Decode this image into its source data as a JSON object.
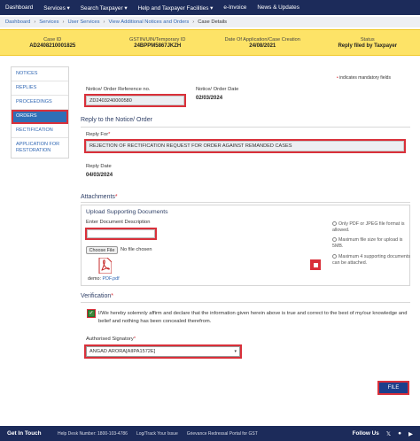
{
  "nav": {
    "items": [
      "Dashboard",
      "Services ▾",
      "Search Taxpayer ▾",
      "Help and Taxpayer Facilities ▾",
      "e-Invoice",
      "News & Updates"
    ]
  },
  "breadcrumb": [
    "Dashboard",
    "Services",
    "User Services",
    "View Additional Notices and Orders",
    "Case Details"
  ],
  "case_info": [
    {
      "label": "Case ID",
      "value": "AD2408210001825"
    },
    {
      "label": "GSTIN/UIN/Temporary ID",
      "value": "24BPPM5867JKZH"
    },
    {
      "label": "Date Of Application/Case Creation",
      "value": "24/08/2021"
    },
    {
      "label": "Status",
      "value": "Reply filed by Taxpayer"
    }
  ],
  "sidebar": {
    "items": [
      "NOTICES",
      "REPLIES",
      "PROCEEDINGS",
      "ORDERS",
      "RECTIFICATION",
      "APPLICATION FOR RESTORATION"
    ]
  },
  "mandatory_note": "indicates mandatory fields",
  "order": {
    "ref_label": "Notice/ Order Reference no.",
    "ref_value": "ZD2403240000580",
    "date_label": "Notice/ Order Date",
    "date_value": "02/03/2024"
  },
  "reply": {
    "section_title": "Reply to the Notice/ Order",
    "reply_for_label": "Reply For",
    "reply_for_value": "REJECTION OF RECTIFICATION REQUEST FOR ORDER AGAINST REMANDED CASES",
    "reply_date_label": "Reply Date",
    "reply_date_value": "04/03/2024"
  },
  "attachments": {
    "section_title": "Attachments",
    "panel_title": "Upload Supporting Documents",
    "desc_label": "Enter Document Description",
    "choose_file": "Choose File",
    "no_file": "No file chosen",
    "demo_prefix": "demo:",
    "demo_link": "PDF.pdf",
    "notes": [
      "Only PDF or JPEG file format is allowed.",
      "Maximum file size for upload is 5MB.",
      "Maximum 4 supporting documents can be attached."
    ]
  },
  "verification": {
    "section_title": "Verification",
    "checkmark": "✓",
    "declaration": "I/We hereby solemnly affirm and declare that the information given herein above is true and correct to the best of my/our knowledge and belief and nothing has been concealed therefrom.",
    "signatory_label": "Authorised Signatory",
    "signatory_value": "ANGAD ARORA[AIIPA1572E]"
  },
  "file_button": "FILE",
  "footer": {
    "get_in_touch": "Get In Touch",
    "items": [
      "Help Desk Number: 1800-103-4786",
      "Log/Track Your Issue",
      "Grievance Redressal Portal for GST"
    ],
    "follow_us": "Follow Us"
  },
  "colors": {
    "navy": "#1c2b5a",
    "yellow": "#fde367",
    "highlight": "#d9303a",
    "active_blue": "#2f6fb7"
  }
}
